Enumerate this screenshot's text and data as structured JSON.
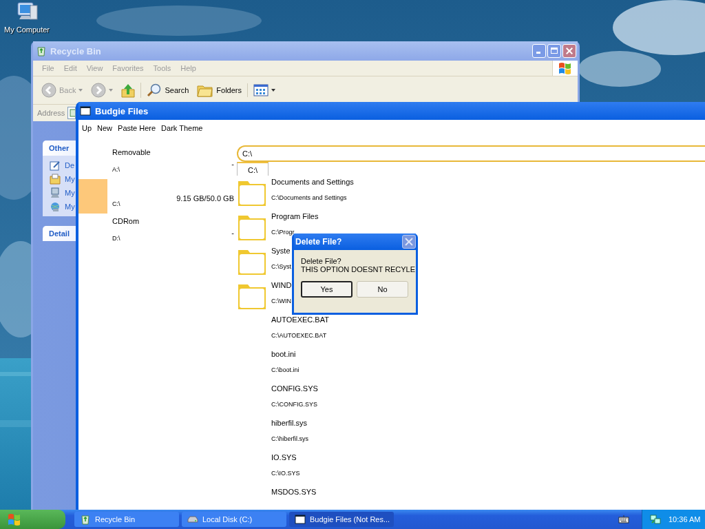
{
  "desktop_icons": [
    {
      "label": "My Computer"
    }
  ],
  "recycle_window": {
    "title": "Recycle Bin",
    "menu": [
      "File",
      "Edit",
      "View",
      "Favorites",
      "Tools",
      "Help"
    ],
    "toolbar": [
      {
        "kind": "back",
        "label": "Back"
      },
      {
        "kind": "forward"
      },
      {
        "kind": "up"
      },
      {
        "kind": "search",
        "label": "Search"
      },
      {
        "kind": "folders",
        "label": "Folders"
      },
      {
        "kind": "views"
      }
    ],
    "address_label": "Address",
    "panels": [
      {
        "title": "Other",
        "items": [
          "De",
          "My",
          "My",
          "My"
        ]
      },
      {
        "title": "Detail"
      }
    ]
  },
  "budgie_window": {
    "title": "Budgie Files",
    "menu": [
      "Up",
      "New",
      "Paste Here",
      "Dark Theme"
    ],
    "drives": [
      {
        "name": "Removable",
        "path": "A:\\",
        "usage": "-",
        "selected": false
      },
      {
        "path": "C:\\",
        "usage": "9.15 GB/50.0 GB",
        "selected": true
      },
      {
        "name": "CDRom",
        "path": "D:\\",
        "usage": "-",
        "selected": false
      }
    ],
    "path_field": {
      "value": "C:\\"
    },
    "tabs": [
      {
        "label": "C:\\",
        "selected": true
      }
    ],
    "items": [
      {
        "kind": "folder",
        "name": "Documents and Settings",
        "path": "C:\\Documents and Settings"
      },
      {
        "kind": "folder",
        "name": "Program Files",
        "path": "C:\\Progr"
      },
      {
        "kind": "folder",
        "name": "Syste",
        "path": "C:\\Syst"
      },
      {
        "kind": "folder",
        "name": "WIND",
        "path": "C:\\WIN"
      },
      {
        "kind": "file",
        "name": "AUTOEXEC.BAT",
        "path": "C:\\AUTOEXEC.BAT"
      },
      {
        "kind": "file",
        "name": "boot.ini",
        "path": "C:\\boot.ini"
      },
      {
        "kind": "file",
        "name": "CONFIG.SYS",
        "path": "C:\\CONFIG.SYS"
      },
      {
        "kind": "file",
        "name": "hiberfil.sys",
        "path": "C:\\hiberfil.sys"
      },
      {
        "kind": "file",
        "name": "IO.SYS",
        "path": "C:\\IO.SYS"
      },
      {
        "kind": "file",
        "name": "MSDOS.SYS"
      }
    ]
  },
  "dialog": {
    "title": "Delete File?",
    "message": [
      "Delete File?",
      "THIS OPTION DOESNT RECYLE"
    ],
    "buttons": [
      {
        "label": "Yes",
        "default": true
      },
      {
        "label": "No",
        "default": false
      }
    ]
  },
  "taskbar": {
    "tasks": [
      {
        "kind": "recycle",
        "label": "Recycle Bin",
        "selected": false
      },
      {
        "kind": "disk",
        "label": "Local Disk (C:)",
        "selected": false
      },
      {
        "kind": "window",
        "label": "Budgie Files (Not Res...",
        "selected": true
      }
    ],
    "clock": "10:36 AM"
  }
}
